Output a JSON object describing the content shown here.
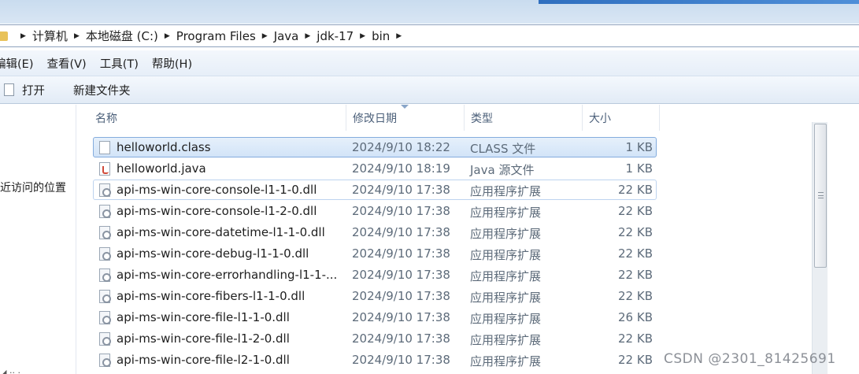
{
  "address_bar": {
    "crumbs": [
      "计算机",
      "本地磁盘 (C:)",
      "Program Files",
      "Java",
      "jdk-17",
      "bin"
    ]
  },
  "menu": {
    "items": [
      "编辑(E)",
      "查看(V)",
      "工具(T)",
      "帮助(H)"
    ]
  },
  "toolbar": {
    "open_label": "打开",
    "new_folder_label": "新建文件夹"
  },
  "nav_pane": {
    "recent_places": "最近访问的位置"
  },
  "columns": {
    "name": "名称",
    "date": "修改日期",
    "type": "类型",
    "size": "大小"
  },
  "files": [
    {
      "name": "helloworld.class",
      "date": "2024/9/10 18:22",
      "type": "CLASS 文件",
      "size": "1 KB",
      "icon": "blank-file-icon"
    },
    {
      "name": "helloworld.java",
      "date": "2024/9/10 18:19",
      "type": "Java 源文件",
      "size": "1 KB",
      "icon": "java-file-icon"
    },
    {
      "name": "api-ms-win-core-console-l1-1-0.dll",
      "date": "2024/9/10 17:38",
      "type": "应用程序扩展",
      "size": "22 KB",
      "icon": "dll-file-icon"
    },
    {
      "name": "api-ms-win-core-console-l1-2-0.dll",
      "date": "2024/9/10 17:38",
      "type": "应用程序扩展",
      "size": "22 KB",
      "icon": "dll-file-icon"
    },
    {
      "name": "api-ms-win-core-datetime-l1-1-0.dll",
      "date": "2024/9/10 17:38",
      "type": "应用程序扩展",
      "size": "22 KB",
      "icon": "dll-file-icon"
    },
    {
      "name": "api-ms-win-core-debug-l1-1-0.dll",
      "date": "2024/9/10 17:38",
      "type": "应用程序扩展",
      "size": "22 KB",
      "icon": "dll-file-icon"
    },
    {
      "name": "api-ms-win-core-errorhandling-l1-1-...",
      "date": "2024/9/10 17:38",
      "type": "应用程序扩展",
      "size": "22 KB",
      "icon": "dll-file-icon"
    },
    {
      "name": "api-ms-win-core-fibers-l1-1-0.dll",
      "date": "2024/9/10 17:38",
      "type": "应用程序扩展",
      "size": "22 KB",
      "icon": "dll-file-icon"
    },
    {
      "name": "api-ms-win-core-file-l1-1-0.dll",
      "date": "2024/9/10 17:38",
      "type": "应用程序扩展",
      "size": "26 KB",
      "icon": "dll-file-icon"
    },
    {
      "name": "api-ms-win-core-file-l1-2-0.dll",
      "date": "2024/9/10 17:38",
      "type": "应用程序扩展",
      "size": "22 KB",
      "icon": "dll-file-icon"
    },
    {
      "name": "api-ms-win-core-file-l2-1-0.dll",
      "date": "2024/9/10 17:38",
      "type": "应用程序扩展",
      "size": "22 KB",
      "icon": "dll-file-icon"
    }
  ],
  "watermark": "CSDN @2301_81425691",
  "colors": {
    "selection": "#d2e4f8",
    "selection_border": "#84acdd",
    "header_text": "#4c607a"
  }
}
